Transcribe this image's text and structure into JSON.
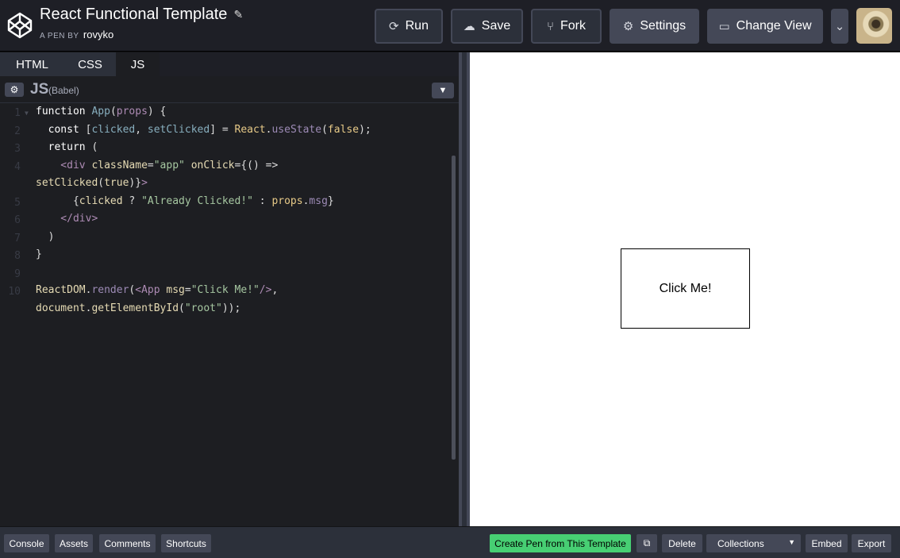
{
  "header": {
    "title": "React Functional Template",
    "by_prefix": "A PEN BY",
    "author": "rovyko",
    "buttons": {
      "run": "Run",
      "save": "Save",
      "fork": "Fork",
      "settings": "Settings",
      "change_view": "Change View"
    }
  },
  "editor": {
    "tabs": [
      "HTML",
      "CSS",
      "JS"
    ],
    "active_tab": "JS",
    "language": "JS",
    "preprocessor": "(Babel)",
    "line_numbers": [
      "1",
      "2",
      "3",
      "4",
      "5",
      "6",
      "7",
      "8",
      "9",
      "10"
    ]
  },
  "preview": {
    "button_text": "Click Me!"
  },
  "footer": {
    "console": "Console",
    "assets": "Assets",
    "comments": "Comments",
    "shortcuts": "Shortcuts",
    "create_template": "Create Pen from This Template",
    "delete": "Delete",
    "collections": "Collections",
    "embed": "Embed",
    "export": "Export"
  },
  "colors": {
    "accent_green": "#47cf73",
    "header_bg": "#1e1f26",
    "button_bg": "#444857"
  }
}
